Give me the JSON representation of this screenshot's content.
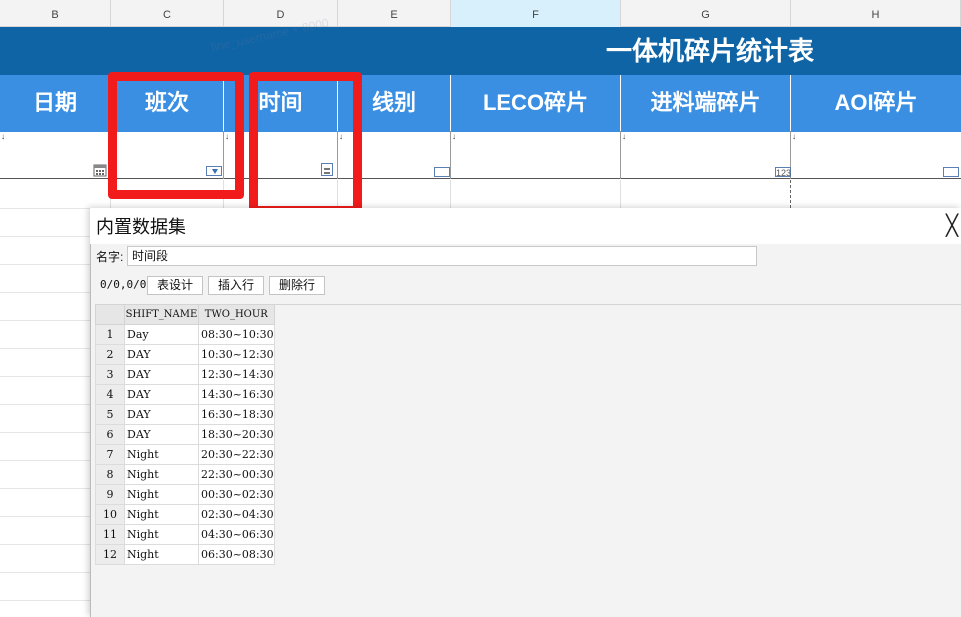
{
  "columns": {
    "letters": [
      "B",
      "C",
      "D",
      "E",
      "F",
      "G",
      "H"
    ],
    "selected": "F"
  },
  "sheet": {
    "title": "一体机碎片统计表",
    "headers": [
      "日期",
      "班次",
      "时间",
      "线别",
      "LECO碎片",
      "进料端碎片",
      "AOI碎片"
    ],
    "filter_icon_text": "123",
    "watermarks": [
      "fine_username + 8000",
      "fine_username + 8000"
    ]
  },
  "colors": {
    "title_band": "#0f64a5",
    "header_band": "#3a8fe3",
    "annotation_red": "#f21b1b"
  },
  "icons": {
    "date_picker": "calendar-icon",
    "dropdown": "dropdown-arrow-icon",
    "close": "close-icon"
  },
  "dialog": {
    "title": "内置数据集",
    "close_glyph": "╳",
    "name_label": "名字:",
    "name_value": "时间段",
    "counter": "0/0,0/0",
    "buttons": {
      "design": "表设计",
      "insert_row": "插入行",
      "delete_row": "删除行"
    },
    "table": {
      "columns": [
        "SHIFT_NAME",
        "TWO_HOUR"
      ],
      "rows": [
        {
          "n": "1",
          "shift": "Day",
          "hour": "08:30~10:30"
        },
        {
          "n": "2",
          "shift": "DAY",
          "hour": "10:30~12:30"
        },
        {
          "n": "3",
          "shift": "DAY",
          "hour": "12:30~14:30"
        },
        {
          "n": "4",
          "shift": "DAY",
          "hour": "14:30~16:30"
        },
        {
          "n": "5",
          "shift": "DAY",
          "hour": "16:30~18:30"
        },
        {
          "n": "6",
          "shift": "DAY",
          "hour": "18:30~20:30"
        },
        {
          "n": "7",
          "shift": "Night",
          "hour": "20:30~22:30"
        },
        {
          "n": "8",
          "shift": "Night",
          "hour": "22:30~00:30"
        },
        {
          "n": "9",
          "shift": "Night",
          "hour": "00:30~02:30"
        },
        {
          "n": "10",
          "shift": "Night",
          "hour": "02:30~04:30"
        },
        {
          "n": "11",
          "shift": "Night",
          "hour": "04:30~06:30"
        },
        {
          "n": "12",
          "shift": "Night",
          "hour": "06:30~08:30"
        }
      ]
    }
  }
}
